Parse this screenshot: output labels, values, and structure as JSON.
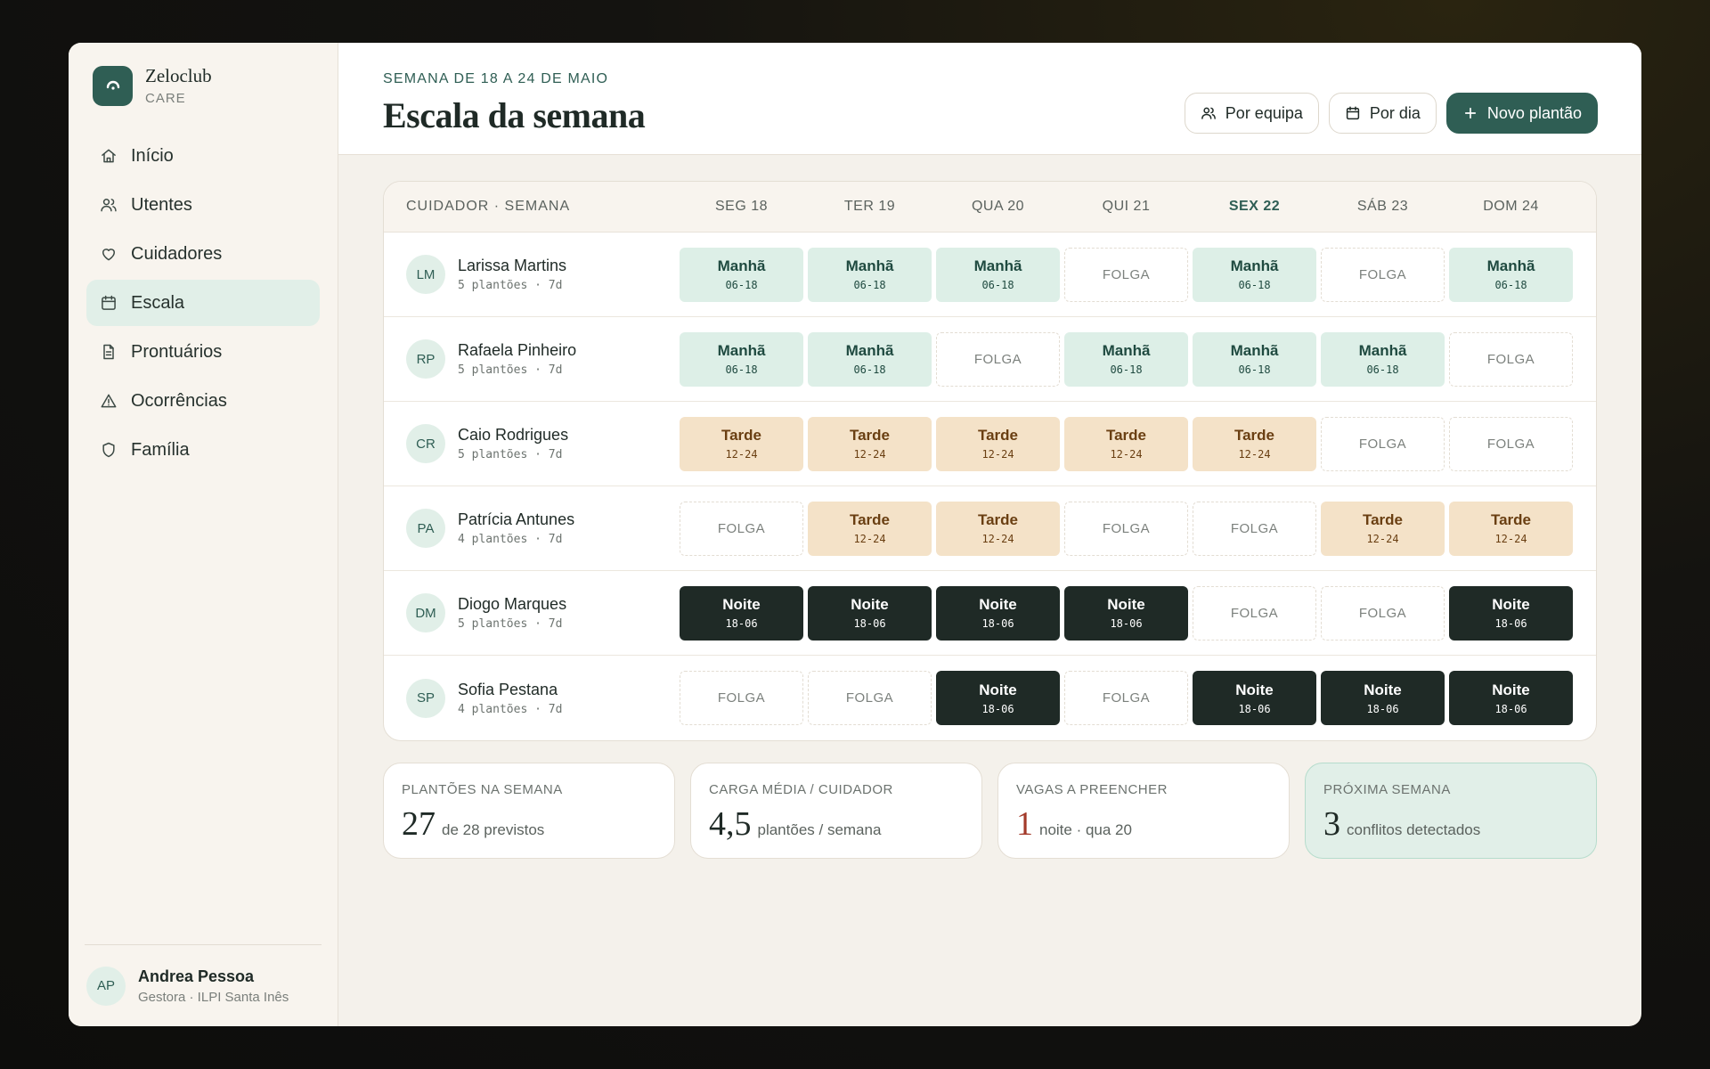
{
  "brand": {
    "name": "Zeloclub",
    "sub": "CARE"
  },
  "nav": [
    {
      "label": "Início",
      "icon": "home-icon",
      "active": false
    },
    {
      "label": "Utentes",
      "icon": "users-icon",
      "active": false
    },
    {
      "label": "Cuidadores",
      "icon": "heart-icon",
      "active": false
    },
    {
      "label": "Escala",
      "icon": "calendar-icon",
      "active": true
    },
    {
      "label": "Prontuários",
      "icon": "document-icon",
      "active": false
    },
    {
      "label": "Ocorrências",
      "icon": "warning-icon",
      "active": false
    },
    {
      "label": "Família",
      "icon": "shield-icon",
      "active": false
    }
  ],
  "user": {
    "initials": "AP",
    "name": "Andrea Pessoa",
    "role": "Gestora · ILPI Santa Inês"
  },
  "header": {
    "eyebrow": "SEMANA DE 18 A 24 DE MAIO",
    "title": "Escala da semana",
    "btn_team": "Por equipa",
    "btn_day": "Por dia",
    "btn_new": "Novo plantão"
  },
  "grid": {
    "person_header": "CUIDADOR · SEMANA",
    "days": [
      "SEG 18",
      "TER 19",
      "QUA 20",
      "QUI 21",
      "SEX 22",
      "SÁB 23",
      "DOM 24"
    ],
    "today_index": 4,
    "shift_types": {
      "M": {
        "label": "Manhã",
        "hours": "06-18",
        "cls": "manha"
      },
      "T": {
        "label": "Tarde",
        "hours": "12-24",
        "cls": "tarde"
      },
      "N": {
        "label": "Noite",
        "hours": "18-06",
        "cls": "noite"
      },
      "F": {
        "label": "FOLGA",
        "hours": "",
        "cls": "folga"
      }
    },
    "rows": [
      {
        "initials": "LM",
        "name": "Larissa Martins",
        "meta": "5 plantões · 7d",
        "shifts": [
          "M",
          "M",
          "M",
          "F",
          "M",
          "F",
          "M"
        ]
      },
      {
        "initials": "RP",
        "name": "Rafaela Pinheiro",
        "meta": "5 plantões · 7d",
        "shifts": [
          "M",
          "M",
          "F",
          "M",
          "M",
          "M",
          "F"
        ]
      },
      {
        "initials": "CR",
        "name": "Caio Rodrigues",
        "meta": "5 plantões · 7d",
        "shifts": [
          "T",
          "T",
          "T",
          "T",
          "T",
          "F",
          "F"
        ]
      },
      {
        "initials": "PA",
        "name": "Patrícia Antunes",
        "meta": "4 plantões · 7d",
        "shifts": [
          "F",
          "T",
          "T",
          "F",
          "F",
          "T",
          "T"
        ]
      },
      {
        "initials": "DM",
        "name": "Diogo Marques",
        "meta": "5 plantões · 7d",
        "shifts": [
          "N",
          "N",
          "N",
          "N",
          "F",
          "F",
          "N"
        ]
      },
      {
        "initials": "SP",
        "name": "Sofia Pestana",
        "meta": "4 plantões · 7d",
        "shifts": [
          "F",
          "F",
          "N",
          "F",
          "N",
          "N",
          "N"
        ]
      }
    ]
  },
  "stats": [
    {
      "label": "PLANTÕES NA SEMANA",
      "value": "27",
      "unit": "de 28 previstos",
      "accent": false,
      "red": false
    },
    {
      "label": "CARGA MÉDIA / CUIDADOR",
      "value": "4,5",
      "unit": "plantões / semana",
      "accent": false,
      "red": false
    },
    {
      "label": "VAGAS A PREENCHER",
      "value": "1",
      "unit": "noite · qua 20",
      "accent": false,
      "red": true
    },
    {
      "label": "PRÓXIMA SEMANA",
      "value": "3",
      "unit": "conflitos detectados",
      "accent": true,
      "red": false
    }
  ]
}
